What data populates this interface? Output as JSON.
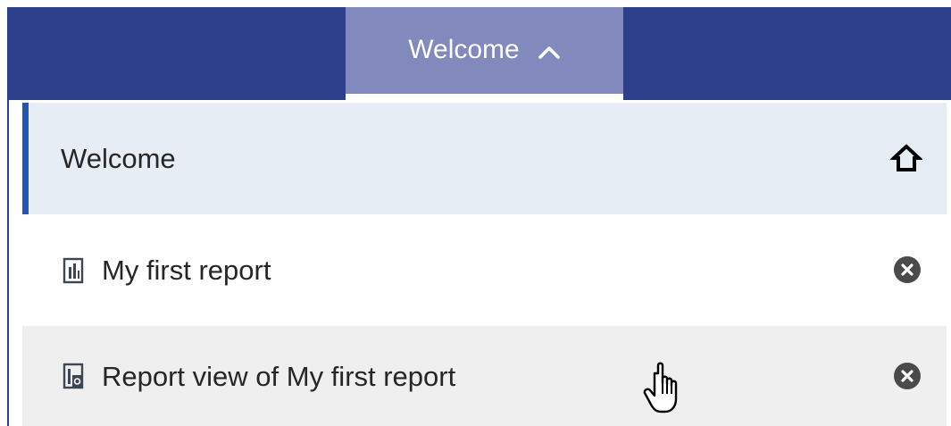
{
  "header": {
    "active_tab_label": "Welcome"
  },
  "menu": {
    "items": [
      {
        "label": "Welcome",
        "icon": "home-icon",
        "selected": true
      },
      {
        "label": "My first report",
        "icon": "report-icon",
        "action_icon": "close-icon"
      },
      {
        "label": "Report view of My first report",
        "icon": "report-view-icon",
        "action_icon": "close-icon"
      }
    ]
  },
  "colors": {
    "header_bg": "#2e3f8c",
    "active_tab_bg": "#8189bd",
    "selected_row_bg": "#e7edf5",
    "selected_row_accent": "#1f57b8",
    "hover_row_bg": "#efefef"
  },
  "cursor": {
    "type": "hand-pointer"
  }
}
